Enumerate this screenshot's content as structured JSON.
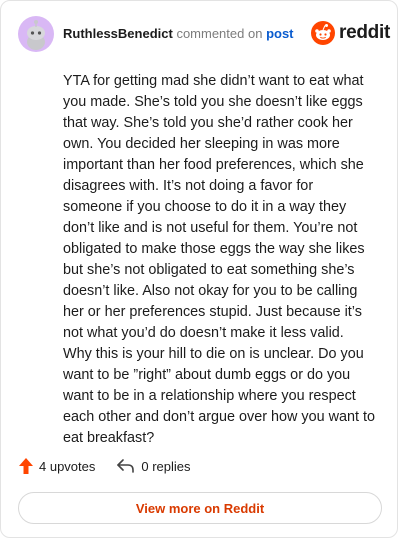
{
  "header": {
    "author": "RuthlessBenedict",
    "action_text": "commented on",
    "post_link": "post"
  },
  "logo": {
    "text": "reddit"
  },
  "comment": {
    "body": "YTA for getting mad she didn’t want to eat what you made. She’s told you she doesn’t like eggs that way. She’s told you she’d rather cook her own. You decided her sleeping in was more important than her food preferences, which she disagrees with. It’s not doing a favor for someone if you choose to do it in a way they don’t like and is not useful for them. You’re not obligated to make those eggs the way she likes but she’s not obligated to eat something she’s doesn’t like. Also not okay for you to be calling her or her preferences stupid. Just because it’s not what you’d do doesn’t make it less valid. Why this is your hill to die on is unclear. Do you want to be ”right” about dumb eggs or do you want to be in a relationship where you respect each other and don’t argue over how you want to eat breakfast?"
  },
  "actions": {
    "upvotes": "4 upvotes",
    "replies": "0 replies"
  },
  "footer": {
    "view_more": "View more on Reddit"
  },
  "colors": {
    "brand_orange": "#ff4500",
    "link_blue": "#0a5ccf",
    "view_more_text": "#d93a00",
    "avatar_bg": "#d9b8f5"
  },
  "icons": {
    "avatar": "snoo-avatar-icon",
    "logo": "reddit-logo-icon",
    "upvote": "upvote-arrow-icon",
    "reply": "reply-arrow-icon"
  }
}
